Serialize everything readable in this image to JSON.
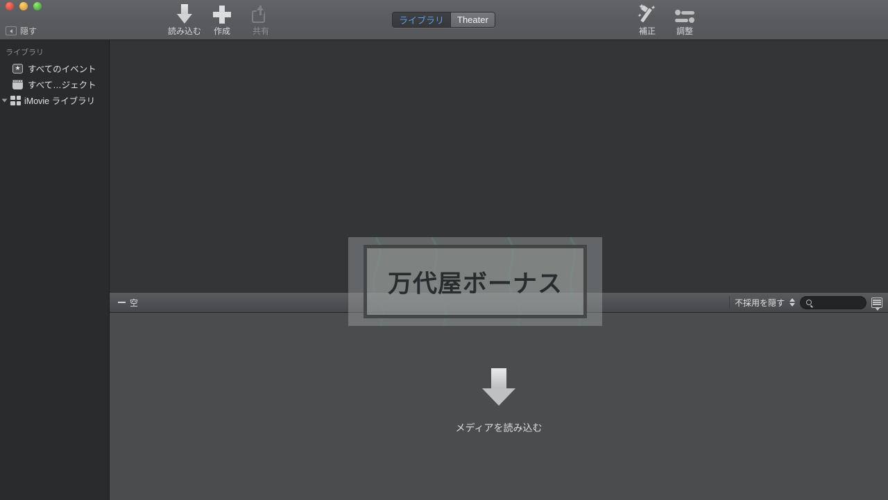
{
  "window": {
    "traffic_lights": [
      "close",
      "minimize",
      "zoom"
    ],
    "hide_button_label": "隠す"
  },
  "toolbar": {
    "items": [
      {
        "label": "読み込む",
        "icon": "arrow-down-icon",
        "enabled": true
      },
      {
        "label": "作成",
        "icon": "plus-icon",
        "enabled": true
      },
      {
        "label": "共有",
        "icon": "share-icon",
        "enabled": false
      },
      {
        "label": "補正",
        "icon": "magic-wand-icon",
        "enabled": true
      },
      {
        "label": "調整",
        "icon": "sliders-icon",
        "enabled": true
      }
    ],
    "segmented": {
      "options": [
        "ライブラリ",
        "Theater"
      ],
      "selected": "ライブラリ",
      "selected_color": "#5f9de8"
    }
  },
  "sidebar": {
    "header": "ライブラリ",
    "items": [
      {
        "label": "すべてのイベント",
        "icon": "star-icon"
      },
      {
        "label": "すべて…ジェクト",
        "icon": "film-icon"
      },
      {
        "label": "iMovie ライブラリ",
        "icon": "grid-icon",
        "expanded": true
      }
    ]
  },
  "divider_bar": {
    "left_label": "空",
    "filter_label": "不採用を隠す",
    "search_value": "",
    "search_placeholder": "",
    "filmstrip_icon": "filmstrip-icon"
  },
  "browser": {
    "import_label": "メディアを読み込む",
    "import_icon": "arrow-down-icon"
  },
  "drag_overlay": {
    "text": "万代屋ボーナス"
  },
  "colors": {
    "toolbar": "#5a5b5f",
    "sidebar": "#2a2b2c",
    "viewer": "#333537",
    "browser": "#4a4c4e",
    "accent": "#5f9de8"
  }
}
